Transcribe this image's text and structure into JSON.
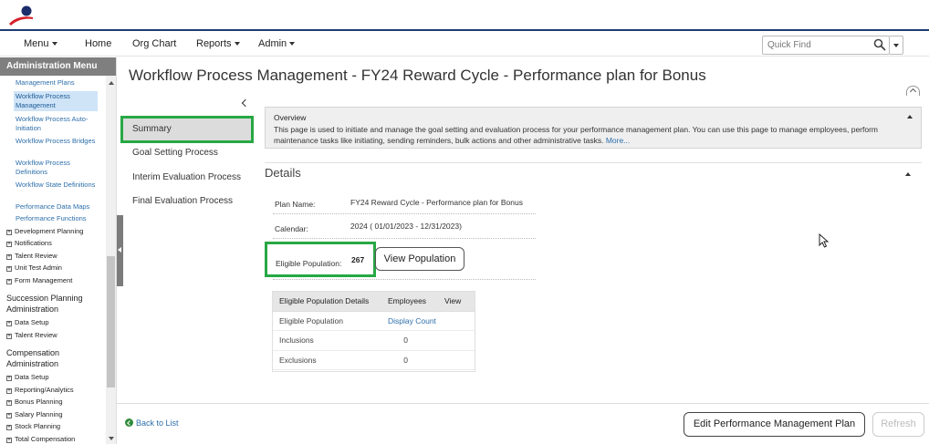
{
  "nav": {
    "menu": "Menu",
    "home": "Home",
    "org_chart": "Org Chart",
    "reports": "Reports",
    "admin": "Admin",
    "quickfind_placeholder": "Quick Find"
  },
  "sidebar": {
    "header": "Administration Menu",
    "links": [
      {
        "label": "Management Plans"
      },
      {
        "label": "Workflow Process Management"
      },
      {
        "label": "Workflow Process Auto-Initiation"
      },
      {
        "label": "Workflow Process Bridges"
      },
      {
        "label": "Workflow Process Definitions"
      },
      {
        "label": "Workflow State Definitions"
      },
      {
        "label": "Performance Data Maps"
      },
      {
        "label": "Performance Functions"
      }
    ],
    "groups1": [
      {
        "label": "Development Planning"
      },
      {
        "label": "Notifications"
      },
      {
        "label": "Talent Review"
      },
      {
        "label": "Unit Test Admin"
      },
      {
        "label": "Form Management"
      }
    ],
    "section_succession": "Succession Planning Administration",
    "groups2": [
      {
        "label": "Data Setup"
      },
      {
        "label": "Talent Review"
      }
    ],
    "section_compensation": "Compensation Administration",
    "groups3": [
      {
        "label": "Data Setup"
      },
      {
        "label": "Reporting/Analytics"
      },
      {
        "label": "Bonus Planning"
      },
      {
        "label": "Salary Planning"
      },
      {
        "label": "Stock Planning"
      },
      {
        "label": "Total Compensation"
      }
    ]
  },
  "page": {
    "title": "Workflow Process Management - FY24 Reward Cycle - Performance plan for Bonus"
  },
  "tabs": {
    "summary": "Summary",
    "goal_setting": "Goal Setting Process",
    "interim_evaluation": "Interim Evaluation Process",
    "final_evaluation": "Final Evaluation Process"
  },
  "overview": {
    "title": "Overview",
    "text": "This page is used to initiate and manage the goal setting and evaluation process for your performance management plan. You can use this page to manage employees, perform maintenance tasks like initiating, sending reminders, bulk actions and other administrative tasks.",
    "more": "More..."
  },
  "details": {
    "title": "Details",
    "plan_name_label": "Plan Name:",
    "plan_name_value": "FY24 Reward Cycle - Performance plan for Bonus",
    "calendar_label": "Calendar:",
    "calendar_value": "2024 ( 01/01/2023 - 12/31/2023)",
    "eligible_label": "Eligible Population:",
    "eligible_count": "267",
    "view_population": "View Population"
  },
  "ep_table": {
    "headers": [
      "Eligible Population Details",
      "Employees",
      "View"
    ],
    "rows": [
      {
        "label": "Eligible Population",
        "value": "Display Count"
      },
      {
        "label": "Inclusions",
        "value": "0"
      },
      {
        "label": "Exclusions",
        "value": "0"
      }
    ]
  },
  "footer": {
    "back": "Back to List",
    "edit": "Edit Performance Management Plan",
    "refresh": "Refresh"
  },
  "colors": {
    "highlight": "#27a844",
    "link": "#2c6eaa",
    "header_rule": "#1f3d73"
  }
}
